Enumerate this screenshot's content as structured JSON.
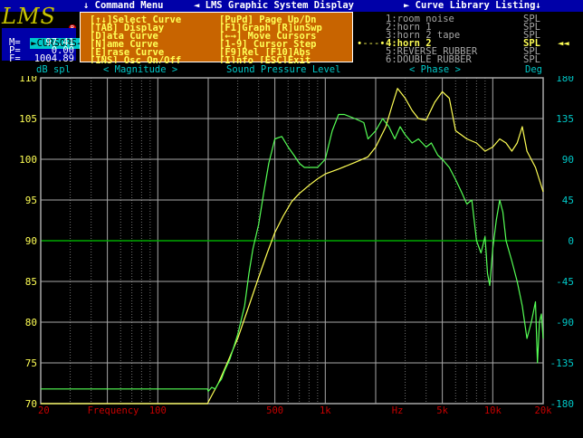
{
  "titlebar": {
    "command_menu": "↓ Command Menu",
    "system_display": "◄ LMS Graphic System Display",
    "library_listing": "► Curve Library Listing↓"
  },
  "logo": {
    "text": "LMS",
    "reg": "R"
  },
  "cursors": {
    "title": "►CURSORS◄",
    "m_label": "M=",
    "m_value": "97.41",
    "p_label": "P=",
    "p_value": "0.00",
    "f_label": "F=",
    "f_value": "1004.89"
  },
  "menu": {
    "rows": [
      [
        "[↑↓]Select Curve",
        "[PuPd] Page Up/Dn"
      ],
      [
        "[TAB] Display",
        "[F1]Graph [R]unSwp"
      ],
      [
        "[D]ata Curve",
        "[←→] Move Cursors"
      ],
      [
        "[N]ame Curve",
        "[1-9] Cursor Step"
      ],
      [
        "[E]rase Curve",
        "[F9]Rel [F10]Abs"
      ],
      [
        "[INS] Osc On/Off",
        "[I]nfo [ESC]Exit"
      ]
    ]
  },
  "library": {
    "items": [
      {
        "label": "1:room noise",
        "unit": "SPL",
        "selected": false,
        "color": "#a8a8a8"
      },
      {
        "label": "2:horn 1",
        "unit": "SPL",
        "selected": false,
        "color": "#a8a8a8"
      },
      {
        "label": "3:horn 2 tape",
        "unit": "SPL",
        "selected": false,
        "color": "#a8a8a8"
      },
      {
        "label": "4:horn 2",
        "unit": "SPL",
        "selected": true,
        "color": "#ffff55"
      },
      {
        "label": "5:REVERSE RUBBER",
        "unit": "SPL",
        "selected": false,
        "color": "#a8a8a8"
      },
      {
        "label": "6:DOUBLE RUBBER",
        "unit": "SPL",
        "selected": false,
        "color": "#a8a8a8"
      }
    ],
    "selected_marker": "∙---∙",
    "selected_arrow": "◄◄"
  },
  "scalebar": {
    "left_label": "dB spl",
    "magnitude": "< Magnitude >",
    "spl": "Sound Pressure Level",
    "phase": "< Phase >",
    "right_label": "Deg"
  },
  "colors": {
    "grid": "#a8a8a8",
    "grid_minor": "#707070",
    "left_axis": "#ffff55",
    "right_axis": "#00c8c8",
    "freq_axis": "#c80000",
    "yellow_curve": "#ffff55",
    "green_curve": "#55ff55",
    "zero_phase": "#00a800"
  },
  "chart_data": {
    "type": "line",
    "x_scale": "log",
    "xlim": [
      20,
      20000
    ],
    "ylim": [
      70,
      110
    ],
    "y2lim": [
      -180,
      180
    ],
    "left_ticks": [
      110,
      105,
      100,
      95,
      90,
      85,
      80,
      75,
      70
    ],
    "right_ticks": [
      180,
      135,
      90,
      45,
      0,
      -45,
      -90,
      -135,
      -180
    ],
    "x_tick_labels": [
      {
        "x": 20,
        "label": "20"
      },
      {
        "x": 38,
        "label": "Frequency"
      },
      {
        "x": 100,
        "label": "100"
      },
      {
        "x": 500,
        "label": "500"
      },
      {
        "x": 1000,
        "label": "1k"
      },
      {
        "x": 2700,
        "label": "Hz"
      },
      {
        "x": 5000,
        "label": "5k"
      },
      {
        "x": 10000,
        "label": "10k"
      },
      {
        "x": 20000,
        "label": "20k"
      }
    ],
    "grid": true,
    "series": [
      {
        "name": "4:horn 2",
        "color": "#ffff55",
        "x": [
          20,
          198,
          210,
          230,
          260,
          300,
          350,
          400,
          450,
          500,
          560,
          630,
          700,
          800,
          900,
          1000,
          1200,
          1500,
          1800,
          2000,
          2300,
          2500,
          2700,
          3000,
          3300,
          3600,
          4000,
          4500,
          5000,
          5500,
          6000,
          7000,
          8000,
          9000,
          10000,
          11000,
          12000,
          13000,
          14000,
          15000,
          16000,
          18000,
          20000
        ],
        "y": [
          70,
          70,
          71,
          72.5,
          75,
          78,
          82,
          85.5,
          88.5,
          91,
          93,
          94.8,
          95.8,
          96.8,
          97.6,
          98.2,
          98.8,
          99.6,
          100.3,
          101.5,
          104,
          106.5,
          108.7,
          107.5,
          106,
          105,
          104.8,
          107,
          108.3,
          107.5,
          103.5,
          102.5,
          102,
          101,
          101.5,
          102.5,
          102,
          101,
          102,
          104,
          101,
          99,
          96
        ]
      },
      {
        "name": "",
        "color": "#55ff55",
        "x": [
          20,
          198,
          200,
          210,
          220,
          230,
          240,
          250,
          270,
          300,
          330,
          350,
          370,
          400,
          430,
          460,
          500,
          550,
          600,
          650,
          700,
          750,
          800,
          900,
          1000,
          1100,
          1200,
          1300,
          1500,
          1700,
          1800,
          2000,
          2200,
          2400,
          2600,
          2800,
          3000,
          3300,
          3600,
          4000,
          4300,
          4700,
          5000,
          5500,
          6000,
          6500,
          7000,
          7500,
          8000,
          8500,
          9000,
          9300,
          9600,
          10000,
          10500,
          11000,
          11500,
          12000,
          13000,
          14000,
          15000,
          16000,
          17000,
          18000,
          18500,
          19000,
          19500,
          20000
        ],
        "y": [
          71.8,
          71.8,
          71.5,
          72,
          71.8,
          72.5,
          73,
          74,
          75.5,
          78.5,
          82,
          86,
          89,
          92,
          96,
          99.5,
          102.5,
          102.8,
          101.5,
          100.5,
          99.5,
          99,
          99,
          99,
          100,
          103.5,
          105.5,
          105.5,
          105,
          104.5,
          102.5,
          103.5,
          105,
          104,
          102.5,
          104,
          103,
          102,
          102.5,
          101.5,
          102,
          100.5,
          100,
          99,
          97.5,
          96,
          94.5,
          95,
          90,
          88.5,
          90.5,
          86,
          84.5,
          89,
          92.5,
          95,
          93.5,
          90,
          87.5,
          85,
          82,
          78,
          80,
          82.5,
          75,
          80,
          81,
          78
        ]
      }
    ]
  }
}
